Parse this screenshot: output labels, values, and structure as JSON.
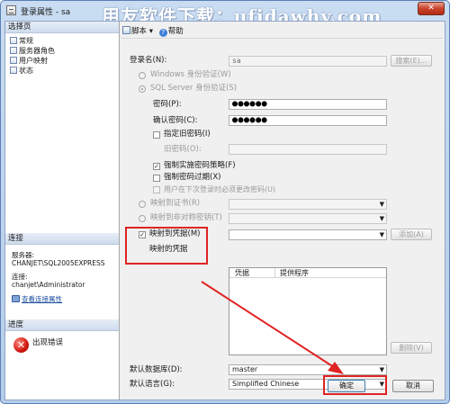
{
  "window": {
    "title": "登录属性 - sa",
    "watermark": "用友软件下载：ufidawhy.com",
    "close_glyph": "✕"
  },
  "left": {
    "select_page_header": "选择页",
    "pages": [
      "常规",
      "服务器角色",
      "用户映射",
      "状态"
    ],
    "connection_header": "连接",
    "server_label": "服务器:",
    "server_value": "CHANJET\\SQL2005EXPRESS",
    "connection_label": "连接:",
    "connection_value": "chanjet\\Administrator",
    "view_connection_link": "查看连接属性",
    "progress_header": "进度",
    "progress_status": "出现错误"
  },
  "toolbar": {
    "script_label": "脚本",
    "help_label": "帮助"
  },
  "general": {
    "login_name_label": "登录名(N):",
    "login_name_value": "sa",
    "search_button": "搜索(E)...",
    "windows_auth_label": "Windows 身份验证(W)",
    "sql_auth_label": "SQL Server 身份验证(S)",
    "password_label": "密码(P):",
    "password_value": "●●●●●●",
    "confirm_password_label": "确认密码(C):",
    "confirm_password_value": "●●●●●●",
    "specify_old_password_label": "指定旧密码(I)",
    "old_password_label": "旧密码(O):",
    "enforce_policy_label": "强制实施密码策略(F)",
    "enforce_expiration_label": "强制密码过期(X)",
    "must_change_label": "用户在下次登录时必须更改密码(U)",
    "map_certificate_label": "映射到证书(R)",
    "map_asymmetric_key_label": "映射到非对称密钥(T)",
    "map_credential_label": "映射到凭据(M)",
    "add_button": "添加(A)",
    "mapped_credentials_label": "映射的凭据",
    "grid_columns": [
      "凭据",
      "提供程序"
    ],
    "remove_button": "删除(V)",
    "default_database_label": "默认数据库(D):",
    "default_database_value": "master",
    "default_language_label": "默认语言(G):",
    "default_language_value": "Simplified Chinese",
    "ok_button": "确定",
    "cancel_button": "取消"
  },
  "colors": {
    "annotation_red": "#e02323",
    "title_bar": "#c9dcf2"
  }
}
